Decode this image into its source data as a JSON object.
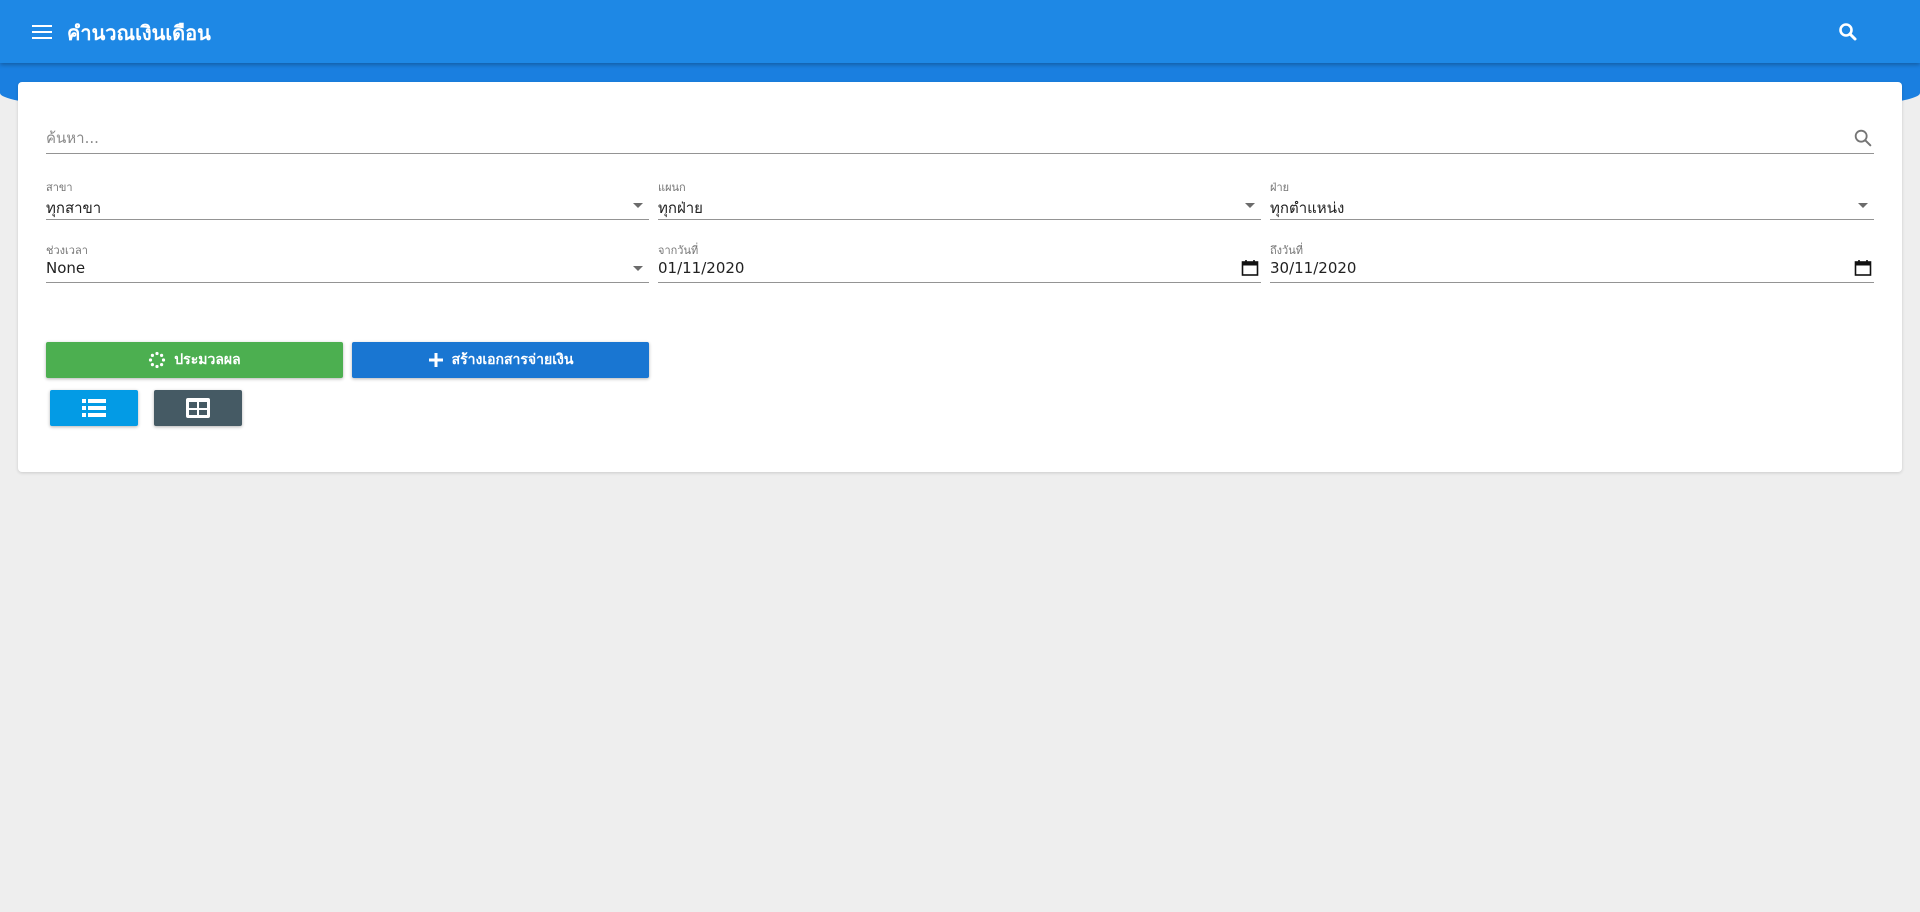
{
  "appbar": {
    "title": "คำนวณเงินเดือน",
    "menu_icon": "menu-icon",
    "search_icon": "search-icon",
    "color": "#1e88e5"
  },
  "search": {
    "placeholder": "ค้นหา...",
    "value": ""
  },
  "filters": {
    "branch": {
      "label": "สาขา",
      "value": "ทุกสาขา"
    },
    "department": {
      "label": "แผนก",
      "value": "ทุกฝ่าย"
    },
    "division": {
      "label": "ฝ่าย",
      "value": "ทุกตำแหน่ง"
    },
    "period": {
      "label": "ช่วงเวลา",
      "value": "None"
    },
    "from_date": {
      "label": "จากวันที่",
      "value": "01/11/2020"
    },
    "to_date": {
      "label": "ถึงวันที่",
      "value": "30/11/2020"
    }
  },
  "actions": {
    "process_label": "ประมวลผล",
    "create_label": "สร้างเอกสารจ่ายเงิน",
    "process_color": "#4caf50",
    "create_color": "#1976d2"
  },
  "view_toggle": {
    "list_icon": "list-view-icon",
    "grid_icon": "grid-view-icon"
  }
}
